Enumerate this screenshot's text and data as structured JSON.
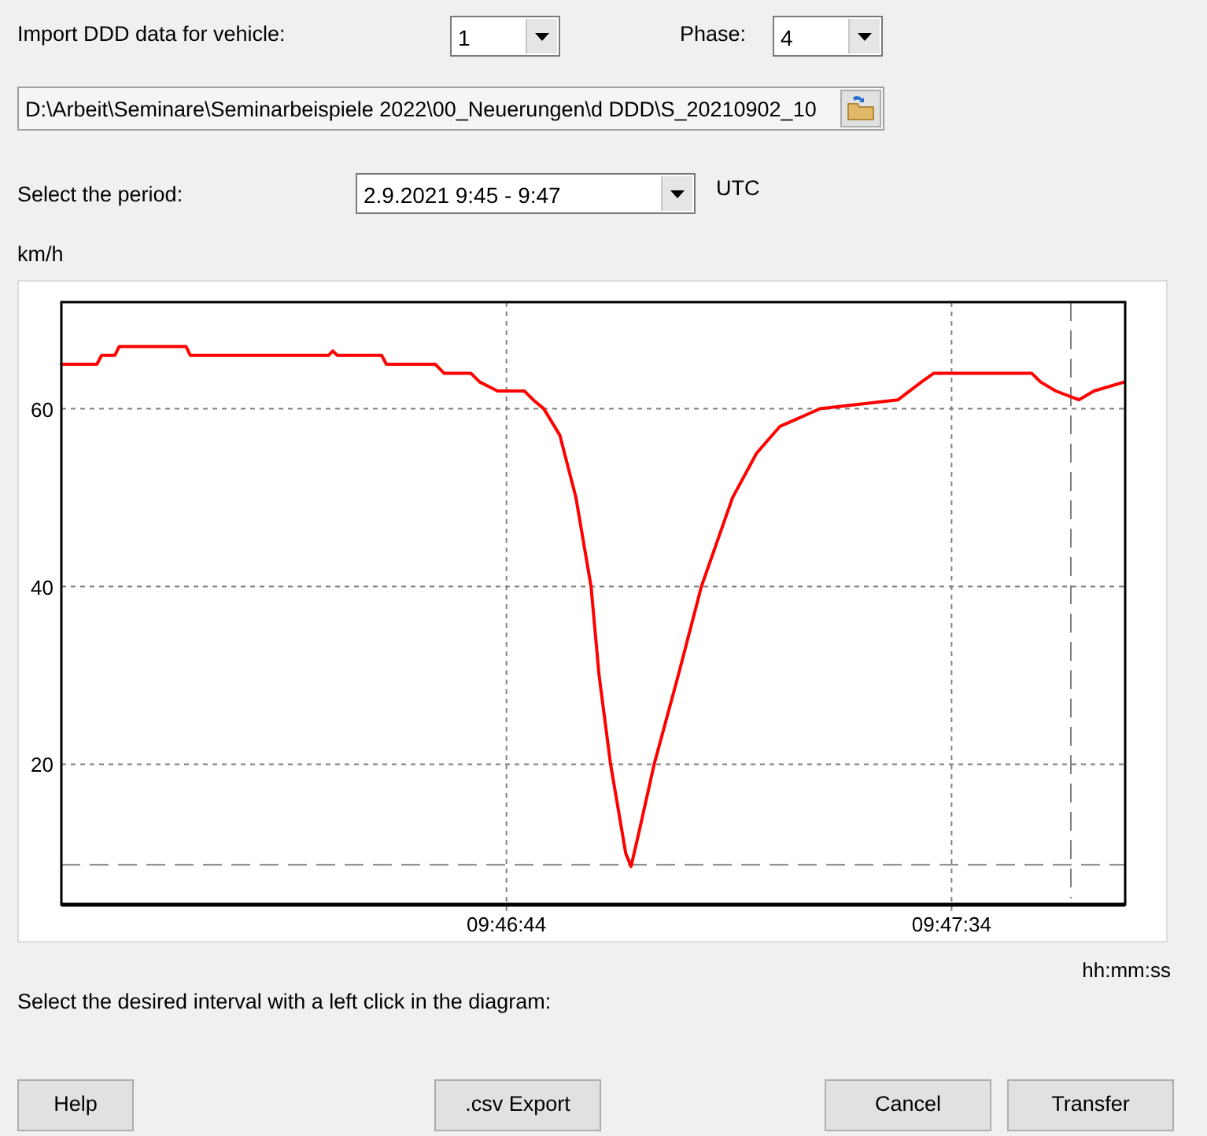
{
  "vehicle": {
    "label": "Import DDD data for vehicle:",
    "value": "1"
  },
  "phase": {
    "label": "Phase:",
    "value": "4"
  },
  "file_path": {
    "value": "D:\\Arbeit\\Seminare\\Seminarbeispiele 2022\\00_Neuerungen\\d DDD\\S_20210902_10"
  },
  "period": {
    "label": "Select the period:",
    "value": "2.9.2021 9:45 - 9:47",
    "timezone": "UTC"
  },
  "chart": {
    "chart_data": {
      "type": "line",
      "ylabel": "km/h",
      "xlabel": "hh:mm:ss",
      "grid": true,
      "xlim": [
        35154,
        35273.5
      ],
      "ylim": [
        4.2,
        72
      ],
      "yticks": [
        20,
        40,
        60
      ],
      "xticks": [
        {
          "value": 35204,
          "label": "09:46:44"
        },
        {
          "value": 35254,
          "label": "09:47:34"
        }
      ],
      "x": [
        35154,
        35158,
        35158.5,
        35160,
        35160.5,
        35162,
        35168,
        35168.5,
        35184,
        35184.5,
        35185,
        35190,
        35190.5,
        35196,
        35197,
        35200,
        35201,
        35203,
        35206,
        35207,
        35208.2,
        35210,
        35211.8,
        35213.5,
        35214.4,
        35215.7,
        35217.4,
        35218,
        35218.8,
        35220.6,
        35223.3,
        35225.9,
        35229.4,
        35232.1,
        35234.7,
        35239.2,
        35248,
        35250.6,
        35252,
        35263,
        35264,
        35265.7,
        35268.3,
        35270,
        35273.4
      ],
      "series": [
        {
          "color": "#ff0000",
          "values": [
            65,
            65,
            66,
            66,
            67,
            67,
            67,
            66,
            66,
            66.5,
            66,
            66,
            65,
            65,
            64,
            64,
            63,
            62,
            62,
            61,
            60,
            57,
            50,
            40,
            30,
            20,
            10,
            8.5,
            12,
            20,
            30,
            40,
            50,
            55,
            58,
            60,
            61,
            63,
            64,
            64,
            63,
            62,
            61,
            62,
            63
          ]
        }
      ],
      "ref_lines": [
        {
          "axis": "y",
          "value": 8.7
        },
        {
          "axis": "x",
          "value": 35267.4
        }
      ]
    }
  },
  "hint": "Select the desired interval with a left click in the diagram:",
  "buttons": [
    {
      "label": "Help"
    },
    {
      "label": ".csv Export"
    },
    {
      "label": "Cancel"
    },
    {
      "label": "Transfer"
    }
  ]
}
